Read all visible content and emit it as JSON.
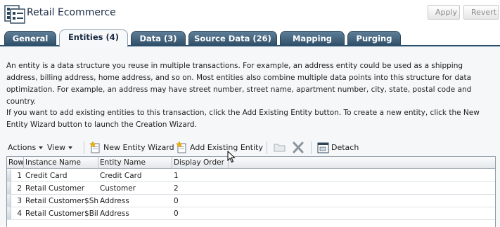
{
  "header": {
    "title": "Retail Ecommerce",
    "apply_label": "Apply",
    "revert_label": "Revert"
  },
  "tabs": [
    {
      "label": "General"
    },
    {
      "label": "Entities (4)",
      "active": true
    },
    {
      "label": "Data (3)"
    },
    {
      "label": "Source Data (26)"
    },
    {
      "label": "Mapping"
    },
    {
      "label": "Purging"
    }
  ],
  "content": {
    "paragraph1": "An entity is a data structure you reuse in multiple transactions. For example, an address entity could be used as a shipping address, billing address, home address, and so on. Most entities also combine multiple data points into this structure for data optimization. For example, an address may have street number, street name, apartment number, city, state, postal code and country.",
    "paragraph2": "If you want to add existing entities to this transaction, click the Add Existing Entity button. To create a new entity, click the New Entity Wizard button to launch the Creation Wizard."
  },
  "toolbar": {
    "actions_label": "Actions",
    "view_label": "View",
    "new_entity_wizard_label": "New Entity Wizard",
    "add_existing_entity_label": "Add Existing Entity",
    "detach_label": "Detach",
    "icons": {
      "new_entity": "new-document-star-icon",
      "add_existing": "add-document-star-icon",
      "open_folder": "folder-icon",
      "delete": "delete-x-icon",
      "detach": "detach-window-icon"
    }
  },
  "table": {
    "columns": [
      "Row",
      "Instance Name",
      "Entity Name",
      "Display Order"
    ],
    "rows": [
      {
        "row": "1",
        "instance_name": "Credit Card",
        "entity_name": "Credit Card",
        "display_order": "1"
      },
      {
        "row": "2",
        "instance_name": "Retail Customer",
        "entity_name": "Customer",
        "display_order": "2"
      },
      {
        "row": "3",
        "instance_name": "Retail Customer$Ship",
        "entity_name": "Address",
        "display_order": "0"
      },
      {
        "row": "4",
        "instance_name": "Retail Customer$Billin",
        "entity_name": "Address",
        "display_order": "0"
      }
    ]
  },
  "colors": {
    "tab_dark": "#2f4e68",
    "tab_active_bg": "#f6f8fa",
    "content_bg": "#f5f7f9",
    "header_title": "#1a2a44"
  }
}
